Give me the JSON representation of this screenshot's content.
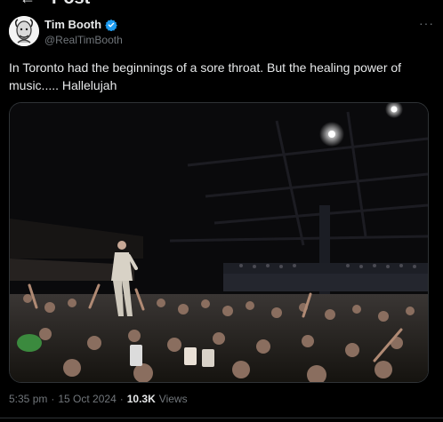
{
  "header": {
    "title": "Post",
    "back_icon": "arrow-left-icon"
  },
  "post": {
    "author_name": "Tim Booth",
    "author_handle": "@RealTimBooth",
    "verified": true,
    "verified_color": "#1d9bf0",
    "more_label": "···",
    "text": "In Toronto had the beginnings of a sore throat. But the healing power of music..... Hallelujah",
    "media_alt": "Concert photo of singer standing above crowd",
    "time": "5:35 pm",
    "date": "15 Oct 2024",
    "separator": "·",
    "views_count": "10.3K",
    "views_label": "Views"
  },
  "colors": {
    "background": "#000000",
    "text": "#e7e9ea",
    "secondary": "#71767b",
    "border": "#2f3336"
  }
}
